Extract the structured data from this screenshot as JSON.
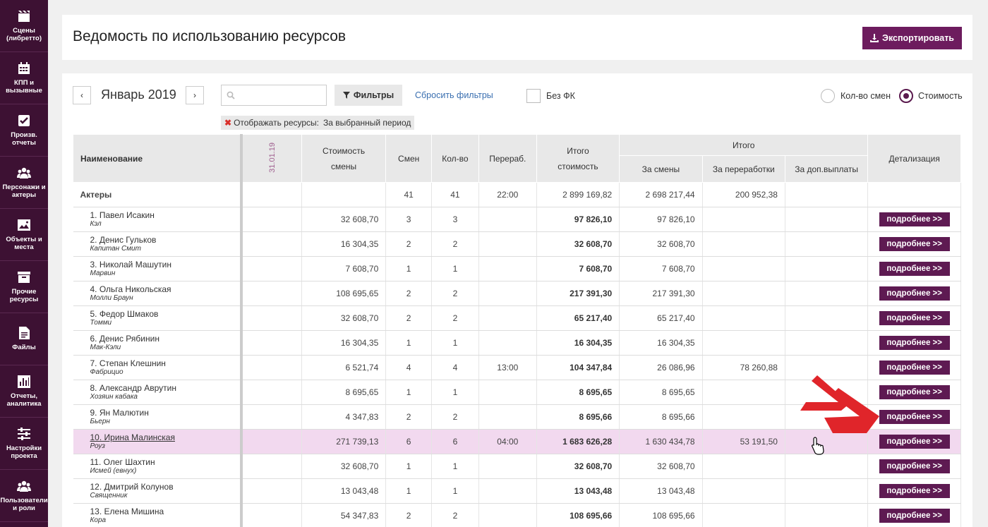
{
  "sidebar": {
    "items": [
      {
        "label": "Сцены (либретто)",
        "icon": "clapperboard-icon"
      },
      {
        "label": "КПП и вызывные",
        "icon": "calendar-icon"
      },
      {
        "label": "Произв. отчеты",
        "icon": "checkbox-icon"
      },
      {
        "label": "Персонажи и актеры",
        "icon": "people-icon"
      },
      {
        "label": "Объекты и места",
        "icon": "image-icon"
      },
      {
        "label": "Прочие ресурсы",
        "icon": "archive-icon"
      },
      {
        "label": "Файлы",
        "icon": "file-icon"
      },
      {
        "label": "Отчеты, аналитика",
        "icon": "bar-chart-icon"
      },
      {
        "label": "Настройки проекта",
        "icon": "sliders-icon"
      },
      {
        "label": "Пользователи и роли",
        "icon": "users-icon"
      }
    ]
  },
  "header": {
    "title": "Ведомость по использованию ресурсов",
    "export_label": "Экспортировать"
  },
  "toolbar": {
    "prev": "‹",
    "next": "›",
    "month": "Январь 2019",
    "search_placeholder": "",
    "filters_label": "Фильтры",
    "reset_label": "Сбросить фильтры",
    "no_fk_label": "Без ФК",
    "no_fk_checked": false,
    "radio_shifts_label": "Кол-во смен",
    "radio_cost_label": "Стоимость",
    "selected_radio": "cost",
    "filter_tag_label": "Отображать ресурсы:",
    "filter_tag_value": "За выбранный период"
  },
  "table": {
    "headers": {
      "name": "Наименование",
      "date": "31.01.19",
      "shift_cost": "Стоимость смены",
      "shifts": "Смен",
      "count": "Кол-во",
      "overtime": "Перераб.",
      "total_cost": "Итого стоимость",
      "total_group": "Итого",
      "for_shifts": "За смены",
      "for_overtime": "За переработки",
      "for_extra": "За доп.выплаты",
      "details": "Детализация"
    },
    "group": {
      "name": "Актеры",
      "shifts": "41",
      "count": "41",
      "overtime": "22:00",
      "total_cost": "2 899 169,82",
      "for_shifts": "2 698 217,44",
      "for_overtime": "200 952,38",
      "for_extra": ""
    },
    "more_label": "подробнее >>",
    "rows": [
      {
        "name": "1. Павел Исакин",
        "role": "Кэл",
        "shift_cost": "32 608,70",
        "shifts": "3",
        "count": "3",
        "overtime": "",
        "total_cost": "97 826,10",
        "for_shifts": "97 826,10",
        "for_overtime": "",
        "for_extra": ""
      },
      {
        "name": "2. Денис Гульков",
        "role": "Капитан Смит",
        "shift_cost": "16 304,35",
        "shifts": "2",
        "count": "2",
        "overtime": "",
        "total_cost": "32 608,70",
        "for_shifts": "32 608,70",
        "for_overtime": "",
        "for_extra": ""
      },
      {
        "name": "3. Николай Машутин",
        "role": "Марвин",
        "shift_cost": "7 608,70",
        "shifts": "1",
        "count": "1",
        "overtime": "",
        "total_cost": "7 608,70",
        "for_shifts": "7 608,70",
        "for_overtime": "",
        "for_extra": ""
      },
      {
        "name": "4. Ольга Никольская",
        "role": "Молли Браун",
        "shift_cost": "108 695,65",
        "shifts": "2",
        "count": "2",
        "overtime": "",
        "total_cost": "217 391,30",
        "for_shifts": "217 391,30",
        "for_overtime": "",
        "for_extra": ""
      },
      {
        "name": "5. Федор Шмаков",
        "role": "Томми",
        "shift_cost": "32 608,70",
        "shifts": "2",
        "count": "2",
        "overtime": "",
        "total_cost": "65 217,40",
        "for_shifts": "65 217,40",
        "for_overtime": "",
        "for_extra": ""
      },
      {
        "name": "6. Денис Рябинин",
        "role": "Мак-Кэли",
        "shift_cost": "16 304,35",
        "shifts": "1",
        "count": "1",
        "overtime": "",
        "total_cost": "16 304,35",
        "for_shifts": "16 304,35",
        "for_overtime": "",
        "for_extra": ""
      },
      {
        "name": "7. Степан Клешнин",
        "role": "Фабрицио",
        "shift_cost": "6 521,74",
        "shifts": "4",
        "count": "4",
        "overtime": "13:00",
        "total_cost": "104 347,84",
        "for_shifts": "26 086,96",
        "for_overtime": "78 260,88",
        "for_extra": ""
      },
      {
        "name": "8. Александр Аврутин",
        "role": "Хозяин кабака",
        "shift_cost": "8 695,65",
        "shifts": "1",
        "count": "1",
        "overtime": "",
        "total_cost": "8 695,65",
        "for_shifts": "8 695,65",
        "for_overtime": "",
        "for_extra": ""
      },
      {
        "name": "9. Ян Малютин",
        "role": "Бьерн",
        "shift_cost": "4 347,83",
        "shifts": "2",
        "count": "2",
        "overtime": "",
        "total_cost": "8 695,66",
        "for_shifts": "8 695,66",
        "for_overtime": "",
        "for_extra": ""
      },
      {
        "name": "10. Ирина Малинская",
        "role": "Роуз",
        "shift_cost": "271 739,13",
        "shifts": "6",
        "count": "6",
        "overtime": "04:00",
        "total_cost": "1 683 626,28",
        "for_shifts": "1 630 434,78",
        "for_overtime": "53 191,50",
        "for_extra": "",
        "highlight": true
      },
      {
        "name": "11. Олег Шахтин",
        "role": "Исмей (евнух)",
        "shift_cost": "32 608,70",
        "shifts": "1",
        "count": "1",
        "overtime": "",
        "total_cost": "32 608,70",
        "for_shifts": "32 608,70",
        "for_overtime": "",
        "for_extra": ""
      },
      {
        "name": "12. Дмитрий Колунов",
        "role": "Священник",
        "shift_cost": "13 043,48",
        "shifts": "1",
        "count": "1",
        "overtime": "",
        "total_cost": "13 043,48",
        "for_shifts": "13 043,48",
        "for_overtime": "",
        "for_extra": ""
      },
      {
        "name": "13. Елена Мишина",
        "role": "Кора",
        "shift_cost": "54 347,83",
        "shifts": "2",
        "count": "2",
        "overtime": "",
        "total_cost": "108 695,66",
        "for_shifts": "108 695,66",
        "for_overtime": "",
        "for_extra": ""
      }
    ]
  },
  "colors": {
    "sidebar_bg": "#3d1133",
    "accent": "#6d1c5e",
    "highlight_row": "#f2d9ef",
    "annotation_arrow": "#e0252a"
  }
}
